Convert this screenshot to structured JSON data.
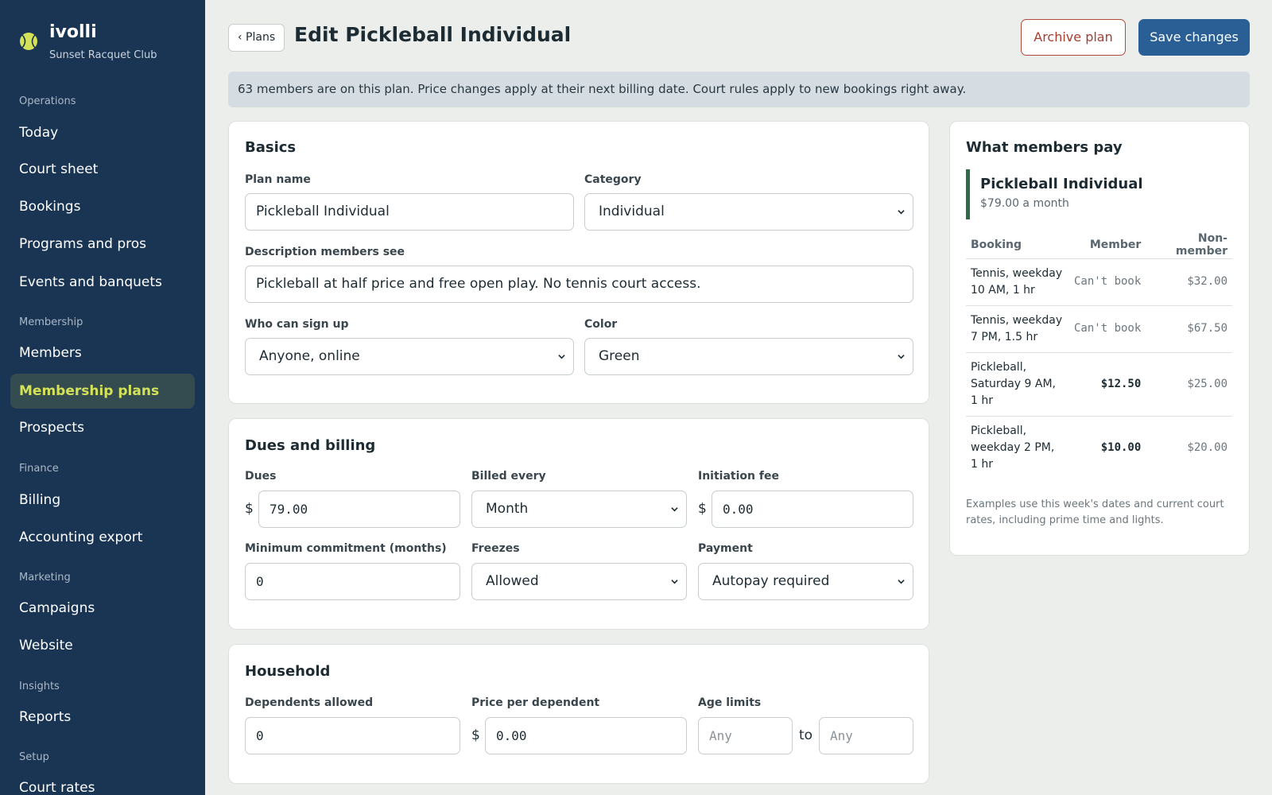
{
  "brand": {
    "name": "ivolli",
    "club": "Sunset Racquet Club",
    "logo_icon": "tennis-ball-icon",
    "logo_color": "#d4e25a"
  },
  "sidebar": {
    "sections": [
      {
        "label": "Operations",
        "items": [
          "Today",
          "Court sheet",
          "Bookings",
          "Programs and pros",
          "Events and banquets"
        ]
      },
      {
        "label": "Membership",
        "items": [
          "Members",
          "Membership plans",
          "Prospects"
        ]
      },
      {
        "label": "Finance",
        "items": [
          "Billing",
          "Accounting export"
        ]
      },
      {
        "label": "Marketing",
        "items": [
          "Campaigns",
          "Website"
        ]
      },
      {
        "label": "Insights",
        "items": [
          "Reports"
        ]
      },
      {
        "label": "Setup",
        "items": [
          "Court rates"
        ]
      }
    ],
    "active": "Membership plans"
  },
  "header": {
    "back_label": "‹ Plans",
    "title": "Edit Pickleball Individual",
    "archive_label": "Archive plan",
    "save_label": "Save changes"
  },
  "notice": "63 members are on this plan. Price changes apply at their next billing date. Court rules apply to new bookings right away.",
  "basics": {
    "title": "Basics",
    "plan_name_label": "Plan name",
    "plan_name_value": "Pickleball Individual",
    "category_label": "Category",
    "category_value": "Individual",
    "description_label": "Description members see",
    "description_value": "Pickleball at half price and free open play. No tennis court access.",
    "signup_label": "Who can sign up",
    "signup_value": "Anyone, online",
    "color_label": "Color",
    "color_value": "Green"
  },
  "dues": {
    "title": "Dues and billing",
    "dues_label": "Dues",
    "currency": "$",
    "dues_value": "79.00",
    "billed_label": "Billed every",
    "billed_value": "Month",
    "init_label": "Initiation fee",
    "init_value": "0.00",
    "min_label": "Minimum commitment (months)",
    "min_value": "0",
    "freezes_label": "Freezes",
    "freezes_value": "Allowed",
    "payment_label": "Payment",
    "payment_value": "Autopay required"
  },
  "household": {
    "title": "Household",
    "dependents_label": "Dependents allowed",
    "dependents_value": "0",
    "price_label": "Price per dependent",
    "price_value": "0.00",
    "age_label": "Age limits",
    "age_min_placeholder": "Any",
    "age_to": "to",
    "age_max_placeholder": "Any"
  },
  "pay_panel": {
    "title": "What members pay",
    "plan_name": "Pickleball Individual",
    "plan_price": "$79.00 a month",
    "accent_color": "#2f6a48",
    "columns": [
      "Booking",
      "Member",
      "Non-member"
    ],
    "rows": [
      {
        "booking": "Tennis, weekday 10 AM, 1 hr",
        "member": "Can't book",
        "non_member": "$32.00"
      },
      {
        "booking": "Tennis, weekday 7 PM, 1.5 hr",
        "member": "Can't book",
        "non_member": "$67.50"
      },
      {
        "booking": "Pickleball, Saturday 9 AM, 1 hr",
        "member": "$12.50",
        "non_member": "$25.00"
      },
      {
        "booking": "Pickleball, weekday 2 PM, 1 hr",
        "member": "$10.00",
        "non_member": "$20.00"
      }
    ],
    "note": "Examples use this week's dates and current court rates, including prime time and lights."
  }
}
